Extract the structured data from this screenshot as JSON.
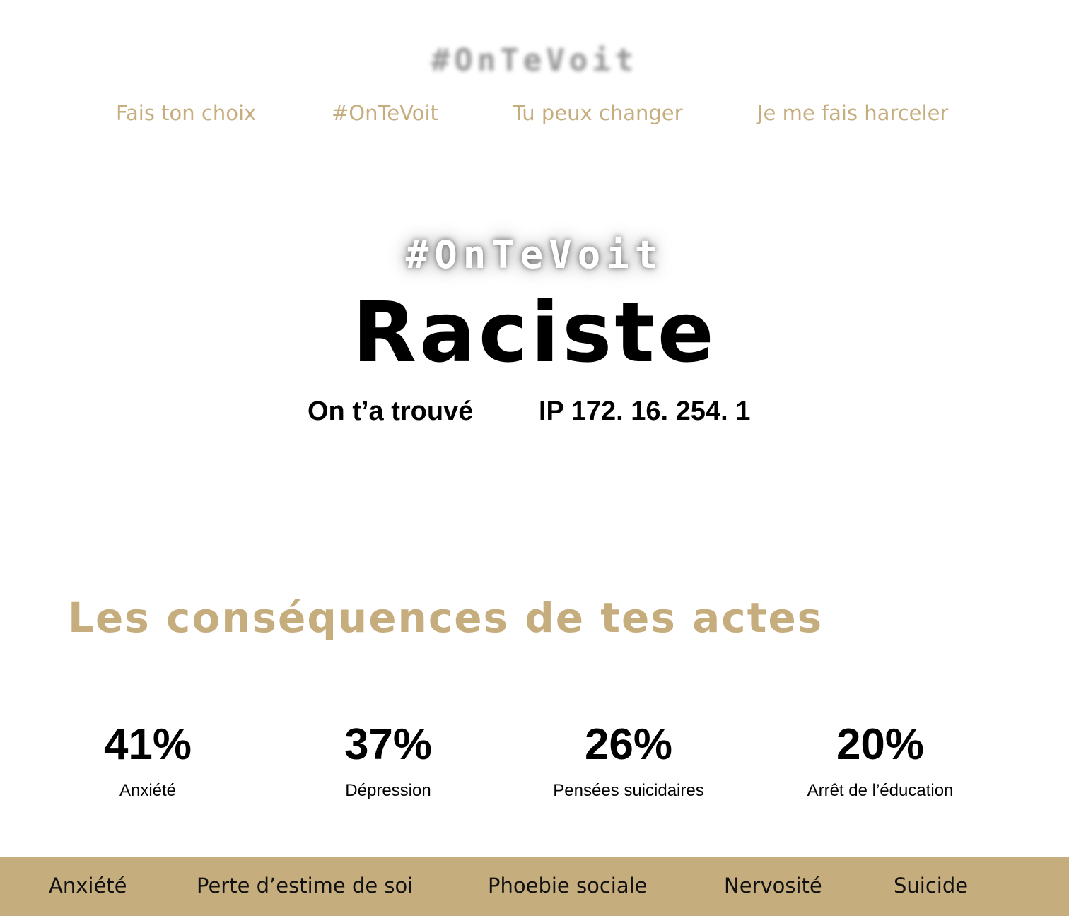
{
  "header": {
    "logo_text": "#OnTeVoit",
    "nav": [
      {
        "label": "Fais ton choix"
      },
      {
        "label": "#OnTeVoit"
      },
      {
        "label": "Tu peux changer"
      },
      {
        "label": "Je me fais harceler"
      }
    ]
  },
  "hero": {
    "tag": "#OnTeVoit",
    "title": "Raciste",
    "found_text": "On t’a trouvé",
    "ip_text": "IP 172. 16. 254. 1"
  },
  "consequences": {
    "title": "Les conséquences de tes actes",
    "stats": [
      {
        "value": "41%",
        "label": "Anxiété"
      },
      {
        "value": "37%",
        "label": "Dépression"
      },
      {
        "value": "26%",
        "label": "Pensées suicidaires"
      },
      {
        "value": "20%",
        "label": "Arrêt de l’éducation"
      }
    ]
  },
  "footer": {
    "items": [
      {
        "label": "Anxiété"
      },
      {
        "label": "Perte d’estime de soi"
      },
      {
        "label": "Phoebie sociale"
      },
      {
        "label": "Nervosité"
      },
      {
        "label": "Suicide"
      }
    ]
  },
  "colors": {
    "accent": "#c6ad7e",
    "text": "#000000",
    "background": "#ffffff"
  }
}
